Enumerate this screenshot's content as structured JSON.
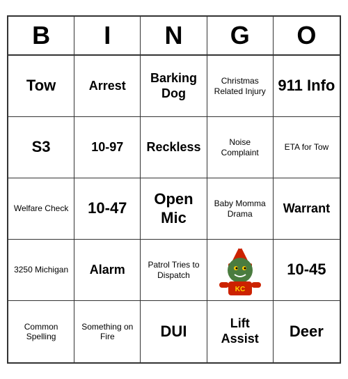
{
  "header": {
    "letters": [
      "B",
      "I",
      "N",
      "G",
      "O"
    ]
  },
  "cells": [
    {
      "text": "Tow",
      "size": "large"
    },
    {
      "text": "Arrest",
      "size": "medium"
    },
    {
      "text": "Barking Dog",
      "size": "medium"
    },
    {
      "text": "Christmas Related Injury",
      "size": "small"
    },
    {
      "text": "911 Info",
      "size": "large"
    },
    {
      "text": "S3",
      "size": "large"
    },
    {
      "text": "10-97",
      "size": "medium"
    },
    {
      "text": "Reckless",
      "size": "medium"
    },
    {
      "text": "Noise Complaint",
      "size": "small"
    },
    {
      "text": "ETA for Tow",
      "size": "small"
    },
    {
      "text": "Welfare Check",
      "size": "small"
    },
    {
      "text": "10-47",
      "size": "large"
    },
    {
      "text": "Open Mic",
      "size": "large"
    },
    {
      "text": "Baby Momma Drama",
      "size": "small"
    },
    {
      "text": "Warrant",
      "size": "medium"
    },
    {
      "text": "3250 Michigan",
      "size": "small"
    },
    {
      "text": "Alarm",
      "size": "medium"
    },
    {
      "text": "Patrol Tries to Dispatch",
      "size": "small"
    },
    {
      "text": "IMAGE",
      "size": "image"
    },
    {
      "text": "10-45",
      "size": "large"
    },
    {
      "text": "Common Spelling",
      "size": "small"
    },
    {
      "text": "Something on Fire",
      "size": "small"
    },
    {
      "text": "DUI",
      "size": "large"
    },
    {
      "text": "Lift Assist",
      "size": "medium"
    },
    {
      "text": "Deer",
      "size": "large"
    }
  ]
}
